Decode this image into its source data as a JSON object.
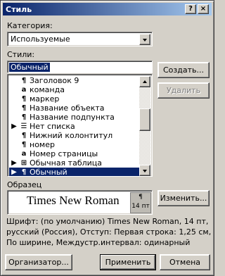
{
  "window": {
    "title": "Стиль",
    "help_glyph": "?",
    "close_glyph": "×"
  },
  "category": {
    "label": "Категория:",
    "value": "Используемые"
  },
  "styles": {
    "label": "Стили:",
    "current": "Обычный",
    "items": [
      {
        "mark": "",
        "icon": "¶",
        "label": "Заголовок 9",
        "selected": false
      },
      {
        "mark": "",
        "icon": "a",
        "label": "команда",
        "selected": false
      },
      {
        "mark": "",
        "icon": "¶",
        "label": "маркер",
        "selected": false
      },
      {
        "mark": "",
        "icon": "¶",
        "label": "Название объекта",
        "selected": false
      },
      {
        "mark": "",
        "icon": "¶",
        "label": "Название подпункта",
        "selected": false
      },
      {
        "mark": "▶",
        "icon": "☰",
        "label": "Нет списка",
        "selected": false
      },
      {
        "mark": "",
        "icon": "¶",
        "label": "Нижний колонтитул",
        "selected": false
      },
      {
        "mark": "",
        "icon": "¶",
        "label": "номер",
        "selected": false
      },
      {
        "mark": "",
        "icon": "a",
        "label": "Номер страницы",
        "selected": false
      },
      {
        "mark": "▶",
        "icon": "⊞",
        "label": "Обычная таблица",
        "selected": false
      },
      {
        "mark": "▶",
        "icon": "¶",
        "label": "Обычный",
        "selected": true
      }
    ]
  },
  "buttons": {
    "create": "Создать...",
    "delete": "Удалить",
    "modify": "Изменить...",
    "organizer": "Организатор...",
    "apply": "Применить",
    "cancel": "Отмена"
  },
  "sample": {
    "label": "Образец",
    "text": "Times New Roman",
    "badge_glyph": "¶",
    "badge_size": "14 пт"
  },
  "description": "Шрифт: (по умолчанию) Times New Roman, 14 пт, русский (Россия), Отступ: Первая строка:  1,25 см, По ширине, Междустр.интервал:  одинарный"
}
